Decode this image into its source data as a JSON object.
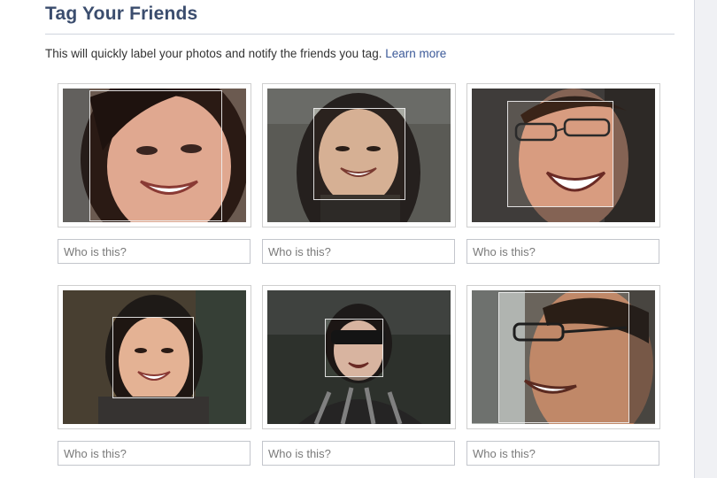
{
  "header": {
    "title": "Tag Your Friends"
  },
  "intro": {
    "text": "This will quickly label your photos and notify the friends you tag.",
    "link": "Learn more"
  },
  "photos": [
    {
      "placeholder": "Who is this?"
    },
    {
      "placeholder": "Who is this?"
    },
    {
      "placeholder": "Who is this?"
    },
    {
      "placeholder": "Who is this?"
    },
    {
      "placeholder": "Who is this?"
    },
    {
      "placeholder": "Who is this?"
    }
  ],
  "colors": {
    "title": "#3b4d6e",
    "link": "#3b5998",
    "border": "#cfcfcf"
  }
}
